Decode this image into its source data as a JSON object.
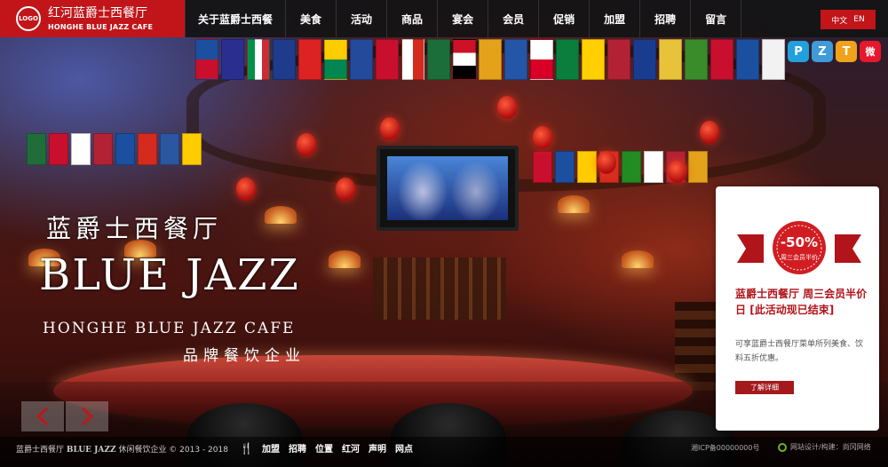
{
  "header": {
    "logo_badge": "LOGO",
    "brand_cn": "红河蓝爵士西餐厅",
    "brand_en": "HONGHE BLUE JAZZ CAFE",
    "nav": [
      "关于蓝爵士西餐",
      "美食",
      "活动",
      "商品",
      "宴会",
      "会员",
      "促销",
      "加盟",
      "招聘",
      "留言"
    ],
    "lang": {
      "cn": "中文",
      "en": "EN"
    },
    "accent_color": "#c1151a"
  },
  "social": [
    {
      "icon": "pinterest-like-p-icon",
      "glyph": "P",
      "color": "#21a0dc"
    },
    {
      "icon": "zhihu-z-icon",
      "glyph": "Z",
      "color": "#3e9bd8"
    },
    {
      "icon": "tencent-t-icon",
      "glyph": "T",
      "color": "#f1a21b"
    },
    {
      "icon": "weibo-icon",
      "glyph": "微",
      "color": "#e6162d"
    }
  ],
  "hero": {
    "title_cn": "蓝爵士西餐厅",
    "title_en": "BLUE JAZZ",
    "subtitle_en": "HONGHE BLUE JAZZ CAFE",
    "slogan": "品牌餐饮企业"
  },
  "promo": {
    "badge_percent": "-50%",
    "badge_caption": "周三会员半价",
    "heading": "蓝爵士西餐厅 周三会员半价日",
    "note": "[此活动现已结束]",
    "description": "可享蓝爵士西餐厅菜单所列美食、饮料五折优惠。",
    "button": "了解详细"
  },
  "footer": {
    "copyright_cn": "蓝爵士西餐厅",
    "copyright_en": "BLUE JAZZ",
    "copyright_rest": "休闲餐饮企业 © 2013 - 2018",
    "links": [
      "加盟",
      "招聘",
      "位置",
      "红河",
      "声明",
      "网点"
    ],
    "icp": "湘ICP备00000000号",
    "designer": "网站设计/构建：尚冈网络"
  }
}
